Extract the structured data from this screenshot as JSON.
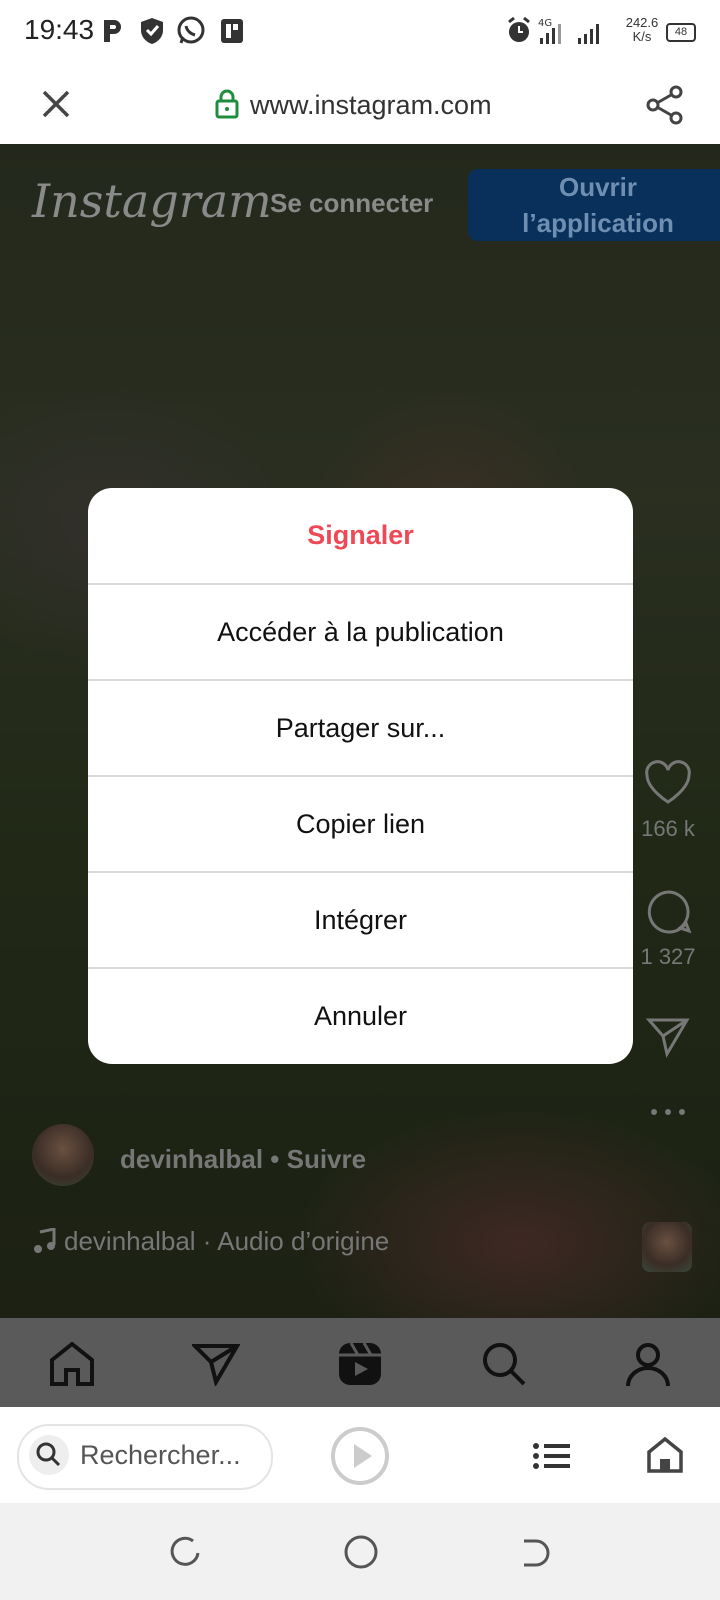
{
  "status_bar": {
    "time": "19:43",
    "network_speed_value": "242.6",
    "network_speed_unit": "K/s",
    "network_type": "4G",
    "battery": "48"
  },
  "browser": {
    "url": "www.instagram.com",
    "search_placeholder": "Rechercher...",
    "lock_color": "#1e8e3e"
  },
  "instagram": {
    "logo": "Instagram",
    "login_link": "Se connecter",
    "open_app_line1": "Ouvrir",
    "open_app_line2": "l’application",
    "likes": "166 k",
    "comments": "1 327",
    "author": "devinhalbal",
    "follow": "Suivre",
    "audio_author": "devinhalbal",
    "audio_label": "Audio d’origine",
    "nav_icons": [
      "home-icon",
      "direct-icon",
      "reels-icon",
      "search-icon",
      "profile-icon"
    ]
  },
  "dialog": {
    "items": [
      {
        "label": "Signaler",
        "color": "#ed4956"
      },
      {
        "label": "Accéder à la publication"
      },
      {
        "label": "Partager sur..."
      },
      {
        "label": "Copier lien"
      },
      {
        "label": "Intégrer"
      },
      {
        "label": "Annuler"
      }
    ]
  }
}
